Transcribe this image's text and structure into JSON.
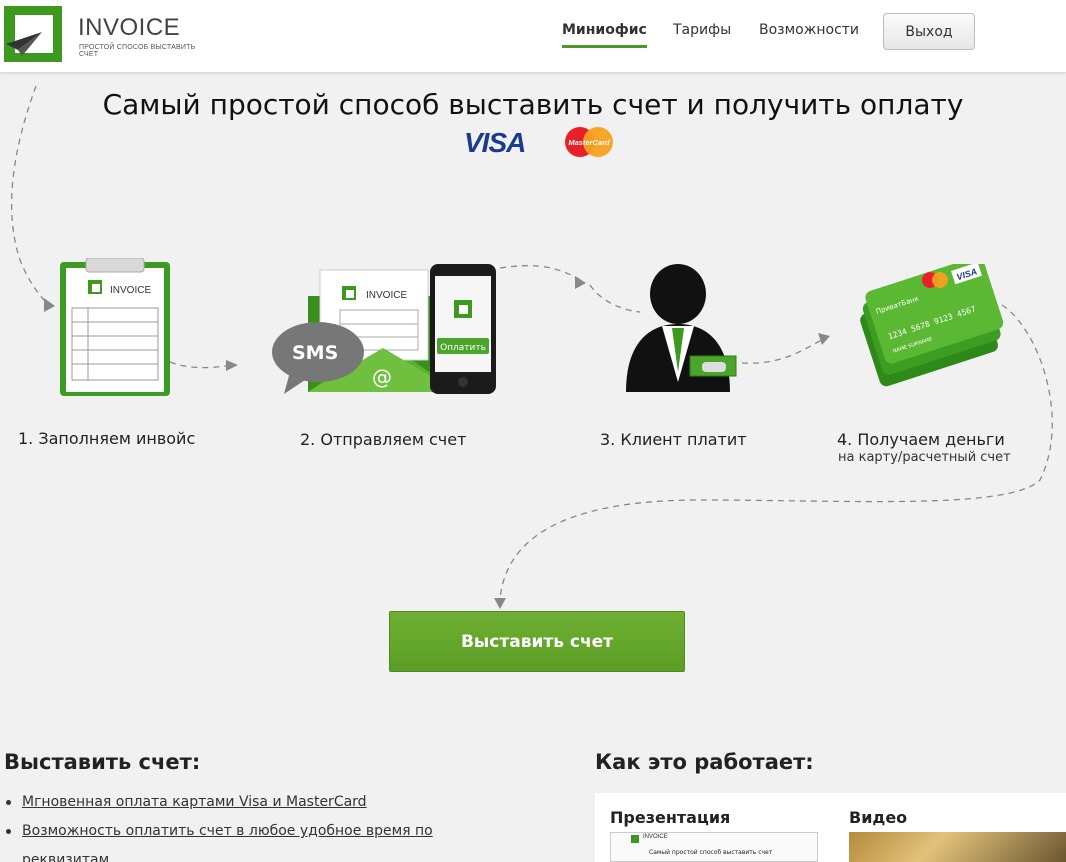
{
  "header": {
    "logo_title": "INVOICE",
    "logo_subtitle": "простой способ выставить счет",
    "nav": [
      {
        "label": "Миниофис",
        "active": true
      },
      {
        "label": "Тарифы",
        "active": false
      },
      {
        "label": "Возможности",
        "active": false
      }
    ],
    "logout_label": "Выход"
  },
  "hero": {
    "title": "Самый простой способ выставить счет и получить оплату",
    "visa_text": "VISA",
    "mastercard_text": "MasterCard"
  },
  "steps": [
    {
      "label": "1. Заполняем инвойс",
      "sub": ""
    },
    {
      "label": "2. Отправляем счет",
      "sub": ""
    },
    {
      "label": "3. Клиент платит",
      "sub": ""
    },
    {
      "label": "4. Получаем деньги",
      "sub": "на карту/расчетный счет"
    }
  ],
  "illustrations": {
    "invoice_doc_title": "INVOICE",
    "sms_text": "SMS",
    "at_sign": "@",
    "pay_button": "Оплатить",
    "card_visa": "VISA",
    "card_number": "1234 5678 9123 4567",
    "card_bank": "ПриватБанк",
    "card_holder": "NAME SURNAME"
  },
  "cta_label": "Выставить счет",
  "features_section": {
    "title": "Выставить счет:",
    "items": [
      "Мгновенная оплата картами Visa и MasterCard",
      "Возможность оплатить счет в любое удобное время по реквизитам"
    ]
  },
  "how_section": {
    "title": "Как это работает:",
    "presentation_label": "Презентация",
    "video_label": "Видео",
    "thumb_title": "Самый простой способ выставить счет"
  },
  "colors": {
    "brand_green": "#3e9a1f",
    "cta_green": "#64a62b",
    "background": "#f1f1f1"
  }
}
